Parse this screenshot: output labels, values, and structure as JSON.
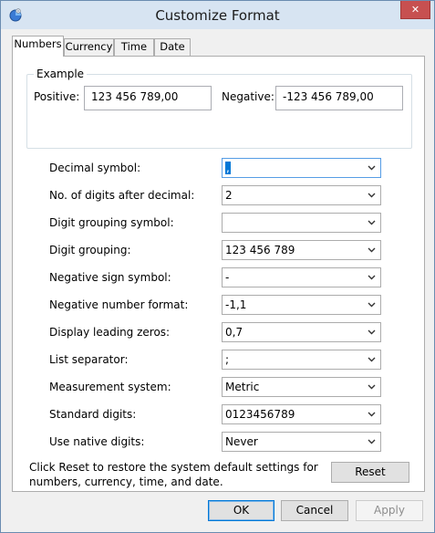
{
  "window": {
    "title": "Customize Format",
    "close_glyph": "✕"
  },
  "tabs": [
    {
      "label": "Numbers",
      "active": true
    },
    {
      "label": "Currency",
      "active": false
    },
    {
      "label": "Time",
      "active": false
    },
    {
      "label": "Date",
      "active": false
    }
  ],
  "example": {
    "legend": "Example",
    "positive_label": "Positive:",
    "positive_value": "123 456 789,00",
    "negative_label": "Negative:",
    "negative_value": "-123 456 789,00"
  },
  "settings": [
    {
      "label": "Decimal symbol:",
      "value": ","
    },
    {
      "label": "No. of digits after decimal:",
      "value": "2"
    },
    {
      "label": "Digit grouping symbol:",
      "value": ""
    },
    {
      "label": "Digit grouping:",
      "value": "123 456 789"
    },
    {
      "label": "Negative sign symbol:",
      "value": "-"
    },
    {
      "label": "Negative number format:",
      "value": "-1,1"
    },
    {
      "label": "Display leading zeros:",
      "value": "0,7"
    },
    {
      "label": "List separator:",
      "value": ";"
    },
    {
      "label": "Measurement system:",
      "value": "Metric"
    },
    {
      "label": "Standard digits:",
      "value": "0123456789"
    },
    {
      "label": "Use native digits:",
      "value": "Never"
    }
  ],
  "reset": {
    "info_text": "Click Reset to restore the system default settings for numbers, currency, time, and date.",
    "button_label": "Reset"
  },
  "footer": {
    "ok_label": "OK",
    "cancel_label": "Cancel",
    "apply_label": "Apply"
  },
  "colors": {
    "accent": "#0078d7",
    "close_button": "#c75050",
    "titlebar": "#d7e4f2"
  }
}
